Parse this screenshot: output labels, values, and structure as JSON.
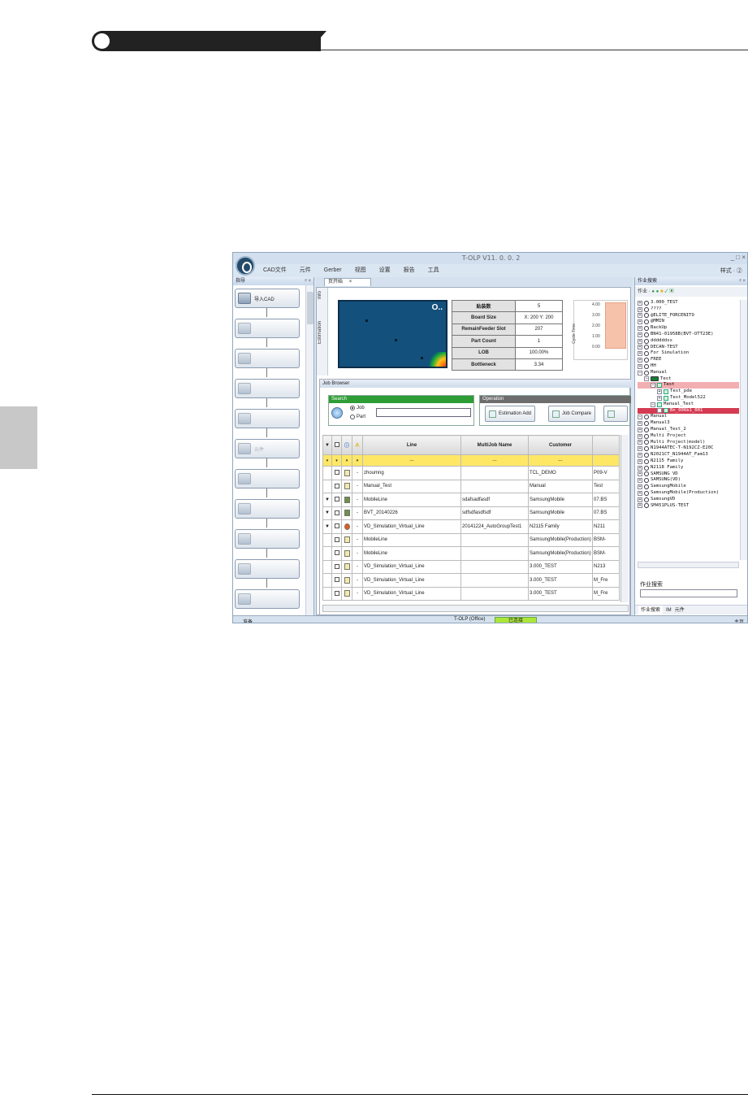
{
  "window": {
    "title": "T-OLP V11. 0. 0. 2",
    "controls": "_ □ ×",
    "style_menu": "样式 · ②"
  },
  "menu": [
    "CAD文件",
    "元件",
    "Gerber",
    "视图",
    "设置",
    "报告",
    "工具"
  ],
  "guide_panel": {
    "title": "指导",
    "steps": [
      {
        "label": "导入CAD",
        "icon": "import-cad-icon",
        "enabled": true
      },
      {
        "label": "",
        "icon": "cad-file-icon",
        "enabled": false
      },
      {
        "label": "",
        "icon": "gerber-icon",
        "enabled": false
      },
      {
        "label": "",
        "icon": "board-icon",
        "enabled": false
      },
      {
        "label": "",
        "icon": "fiducial-icon",
        "enabled": false
      },
      {
        "label": "元件",
        "icon": "component-icon",
        "enabled": false
      },
      {
        "label": "",
        "icon": "nozzle-icon",
        "enabled": false
      },
      {
        "label": "",
        "icon": "feeder-icon",
        "enabled": false
      },
      {
        "label": "",
        "icon": "optimize-icon",
        "enabled": false
      },
      {
        "label": "",
        "icon": "simulation-icon",
        "enabled": false
      },
      {
        "label": "",
        "icon": "output-icon",
        "enabled": false
      }
    ]
  },
  "doc_tab": {
    "label": "页开始",
    "close": "×"
  },
  "side_tabs": [
    "Info",
    "Estimation"
  ],
  "estimation": {
    "rows": [
      {
        "key": "贴装数",
        "value": "5"
      },
      {
        "key": "Board Size",
        "value": "X: 200  Y: 200"
      },
      {
        "key": "RemainFeeder Slot",
        "value": "207"
      },
      {
        "key": "Part Count",
        "value": "1"
      },
      {
        "key": "LOB",
        "value": "100.00%"
      },
      {
        "key": "Bottleneck",
        "value": "3.34"
      }
    ],
    "cycle_time_label": "Cycle Time",
    "cycle_ticks": [
      "4.00",
      "3.00",
      "2.00",
      "1.00",
      "0.00"
    ],
    "board_logo": "O.."
  },
  "job_browser": {
    "title": "Job Browser",
    "search": {
      "title": "Search",
      "options": [
        "Job",
        "Part"
      ],
      "selected": "Job",
      "value": ""
    },
    "operation": {
      "title": "Operation",
      "buttons": [
        "Estimation Add",
        "Job Compare"
      ]
    },
    "columns": [
      "Line",
      "MultiJob Name",
      "Customer"
    ],
    "filter_placeholder": "---",
    "rows": [
      {
        "arrow": "",
        "line": "zhoumng",
        "multijob": "",
        "customer": "TCL_DEMO",
        "extra": "P09-V",
        "status": "doc"
      },
      {
        "arrow": "",
        "line": "Manual_Test",
        "multijob": "",
        "customer": "Manual",
        "extra": "Test",
        "status": "doc"
      },
      {
        "arrow": "▼",
        "line": "MobileLine",
        "multijob": "sdafsadfasdf",
        "customer": "SamsungMobile",
        "extra": "07.BS",
        "status": "multi"
      },
      {
        "arrow": "▼",
        "line": "BVT_20140226",
        "multijob": "sdfsdfasdfsdf",
        "customer": "SamsungMobile",
        "extra": "07.BS",
        "status": "multi"
      },
      {
        "arrow": "▼",
        "line": "VD_Simulation_Virtual_Line",
        "multijob": "20141224_AutoGroupTest1",
        "customer": "N2115 Family",
        "extra": "N211",
        "status": "warn"
      },
      {
        "arrow": "",
        "line": "MobileLine",
        "multijob": "",
        "customer": "SamsungMobile(Production)",
        "extra": "BSM-",
        "status": "doc"
      },
      {
        "arrow": "",
        "line": "MobileLine",
        "multijob": "",
        "customer": "SamsungMobile(Production)",
        "extra": "BSM-",
        "status": "doc"
      },
      {
        "arrow": "",
        "line": "VD_Simulation_Virtual_Line",
        "multijob": "",
        "customer": "3.000_TEST",
        "extra": "N213",
        "status": "doc"
      },
      {
        "arrow": "",
        "line": "VD_Simulation_Virtual_Line",
        "multijob": "",
        "customer": "3.000_TEST",
        "extra": "M_Fre",
        "status": "doc"
      },
      {
        "arrow": "",
        "line": "VD_Simulation_Virtual_Line",
        "multijob": "",
        "customer": "3.000_TEST",
        "extra": "M_Fre",
        "status": "doc"
      }
    ]
  },
  "job_search_panel": {
    "title": "作业搜索",
    "toolbar": "作业 ·",
    "tree": [
      {
        "indent": 0,
        "label": "3.000_TEST",
        "type": "node"
      },
      {
        "indent": 0,
        "label": "????",
        "type": "node"
      },
      {
        "indent": 0,
        "label": "@ELITE_FORCENITO",
        "type": "node"
      },
      {
        "indent": 0,
        "label": "@MMIN",
        "type": "node"
      },
      {
        "indent": 0,
        "label": "BackUp",
        "type": "node"
      },
      {
        "indent": 0,
        "label": "BN41-01958B(BVT-OTT23E)",
        "type": "node"
      },
      {
        "indent": 0,
        "label": "ddddddss",
        "type": "node"
      },
      {
        "indent": 0,
        "label": "DECAN-TEST",
        "type": "node"
      },
      {
        "indent": 0,
        "label": "For Simulation",
        "type": "node"
      },
      {
        "indent": 0,
        "label": "FREE",
        "type": "node"
      },
      {
        "indent": 0,
        "label": "HH",
        "type": "node"
      },
      {
        "indent": 0,
        "label": "Manual",
        "type": "node"
      },
      {
        "indent": 1,
        "label": "Test",
        "type": "folder"
      },
      {
        "indent": 2,
        "label": "Test",
        "type": "doc",
        "hl": "hl"
      },
      {
        "indent": 3,
        "label": "Test_pde",
        "type": "doc"
      },
      {
        "indent": 3,
        "label": "Test_Model522",
        "type": "doc"
      },
      {
        "indent": 2,
        "label": "Manual_Test",
        "type": "doc"
      },
      {
        "indent": 3,
        "label": "Bn_006b1_001",
        "type": "doc",
        "hl": "hl2"
      },
      {
        "indent": 0,
        "label": "Manual",
        "type": "node"
      },
      {
        "indent": 0,
        "label": "Manual3",
        "type": "node"
      },
      {
        "indent": 0,
        "label": "Manual_Test_2",
        "type": "node"
      },
      {
        "indent": 0,
        "label": "Multi Project",
        "type": "node"
      },
      {
        "indent": 0,
        "label": "Multi Project(model)",
        "type": "node"
      },
      {
        "indent": 0,
        "label": "N1944ATEC-T-N192CZ-E20C",
        "type": "node"
      },
      {
        "indent": 0,
        "label": "N2021CT_N1944AT_Fam13",
        "type": "node"
      },
      {
        "indent": 0,
        "label": "N2115 Family",
        "type": "node"
      },
      {
        "indent": 0,
        "label": "N2118 Family",
        "type": "node"
      },
      {
        "indent": 0,
        "label": "SAMSUNG VD",
        "type": "node"
      },
      {
        "indent": 0,
        "label": "SAMSUNG(VD)",
        "type": "node"
      },
      {
        "indent": 0,
        "label": "SamsungMobile",
        "type": "node"
      },
      {
        "indent": 0,
        "label": "SamsungMobile(Production)",
        "type": "node"
      },
      {
        "indent": 0,
        "label": "SamsungVD",
        "type": "node"
      },
      {
        "indent": 0,
        "label": "SM451PLUS-TEST",
        "type": "node"
      }
    ],
    "search_label": "作业搜索",
    "tabs": [
      "作业搜索",
      "IM",
      "元件"
    ]
  },
  "status": {
    "left": "准备",
    "mode": "T-OLP (Office)",
    "connection": "已连接",
    "right": "主页"
  }
}
